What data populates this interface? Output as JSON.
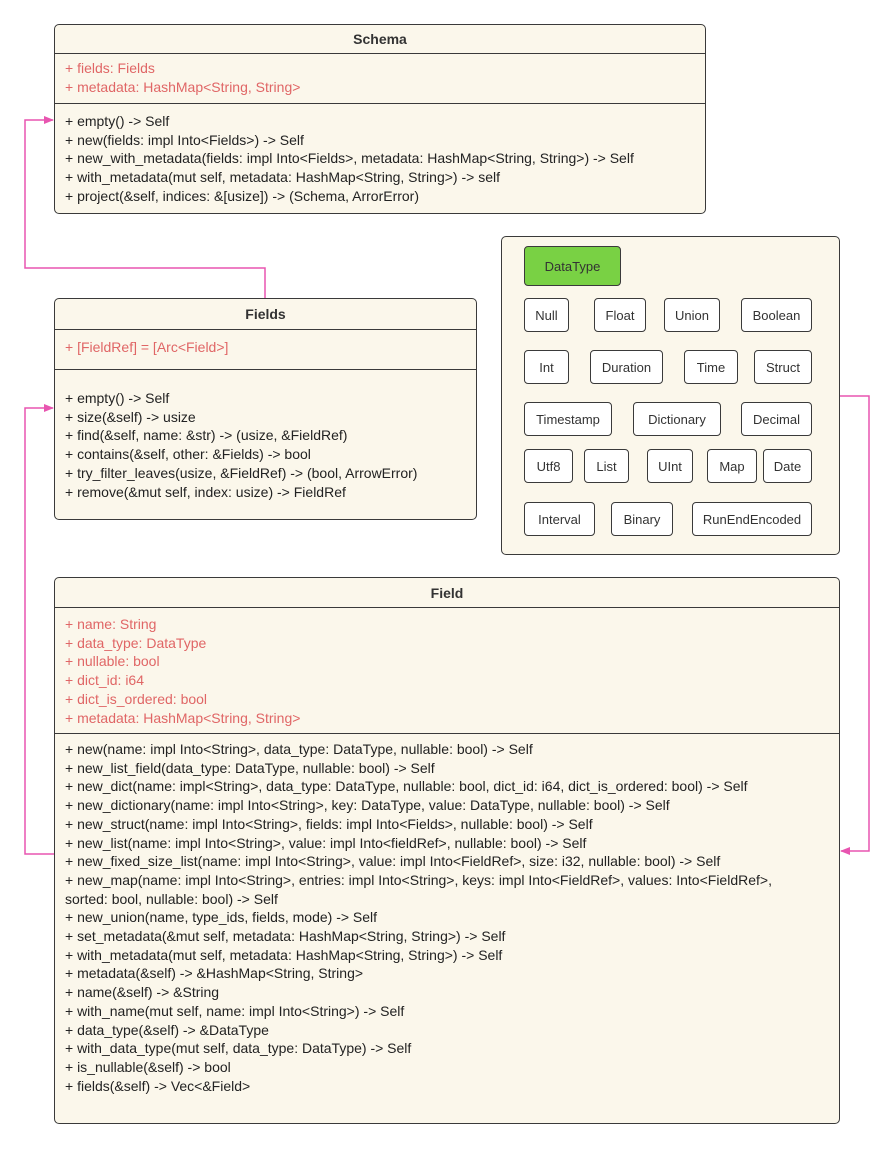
{
  "colors": {
    "class_fill": "#fbf7eb",
    "border": "#3a3a3a",
    "attribute_text": "#e06666",
    "method_text": "#222222",
    "link": "#e855b0",
    "datatype_root_fill": "#79d144"
  },
  "schema": {
    "title": "Schema",
    "attributes": [
      "+ fields: Fields",
      "+ metadata: HashMap<String, String>"
    ],
    "methods": [
      "+ empty() -> Self",
      "+ new(fields: impl Into<Fields>) -> Self",
      "+ new_with_metadata(fields: impl Into<Fields>, metadata: HashMap<String, String>) -> Self",
      "+ with_metadata(mut self, metadata: HashMap<String, String>) -> self",
      "+ project(&self, indices: &[usize]) -> (Schema, ArrorError)"
    ]
  },
  "fields": {
    "title": "Fields",
    "attributes": [
      "+ [FieldRef] = [Arc<Field>]"
    ],
    "methods": [
      "+ empty() -> Self",
      "+ size(&self) -> usize",
      "+ find(&self, name: &str) -> (usize, &FieldRef)",
      "+ contains(&self, other: &Fields) -> bool",
      "+ try_filter_leaves(usize, &FieldRef) -> (bool, ArrowError)",
      "+ remove(&mut self, index: usize) -> FieldRef"
    ]
  },
  "field": {
    "title": "Field",
    "attributes": [
      "+ name: String",
      "+ data_type: DataType",
      "+ nullable: bool",
      "+ dict_id: i64",
      "+ dict_is_ordered: bool",
      "+ metadata: HashMap<String, String>"
    ],
    "methods": [
      "+ new(name: impl Into<String>, data_type: DataType, nullable: bool) -> Self",
      "+ new_list_field(data_type: DataType, nullable: bool) -> Self",
      "+ new_dict(name: impl<String>, data_type: DataType, nullable: bool, dict_id: i64, dict_is_ordered: bool) -> Self",
      "+ new_dictionary(name: impl Into<String>, key: DataType, value: DataType, nullable: bool) -> Self",
      "+ new_struct(name: impl Into<String>, fields: impl Into<Fields>, nullable: bool) -> Self",
      "+ new_list(name: impl Into<String>, value: impl Into<fieldRef>, nullable: bool) -> Self",
      "+ new_fixed_size_list(name: impl Into<String>, value: impl Into<FieldRef>, size: i32, nullable: bool) -> Self",
      "+ new_map(name: impl Into<String>, entries: impl Into<String>, keys: impl Into<FieldRef>, values: Into<FieldRef>,",
      "sorted: bool, nullable: bool) -> Self",
      "+ new_union(name, type_ids, fields, mode) -> Self",
      "+ set_metadata(&mut self, metadata: HashMap<String, String>) -> Self",
      "+ with_metadata(mut self, metadata: HashMap<String, String>) -> Self",
      "+ metadata(&self) -> &HashMap<String, String>",
      "+ name(&self) -> &String",
      "+ with_name(mut self, name: impl Into<String>) -> Self",
      "+ data_type(&self) -> &DataType",
      "+ with_data_type(mut self, data_type: DataType) -> Self",
      "+ is_nullable(&self) -> bool",
      "+ fields(&self) -> Vec<&Field>"
    ]
  },
  "datatypes": {
    "root": "DataType",
    "variants": [
      "Null",
      "Float",
      "Union",
      "Boolean",
      "Int",
      "Duration",
      "Time",
      "Struct",
      "Timestamp",
      "Dictionary",
      "Decimal",
      "Utf8",
      "List",
      "UInt",
      "Map",
      "Date",
      "Interval",
      "Binary",
      "RunEndEncoded"
    ]
  },
  "links": [
    {
      "from": "Fields",
      "to": "Schema",
      "label": ""
    },
    {
      "from": "Field",
      "to": "Fields",
      "label": ""
    },
    {
      "from": "DataType",
      "to": "Field",
      "label": ""
    }
  ]
}
